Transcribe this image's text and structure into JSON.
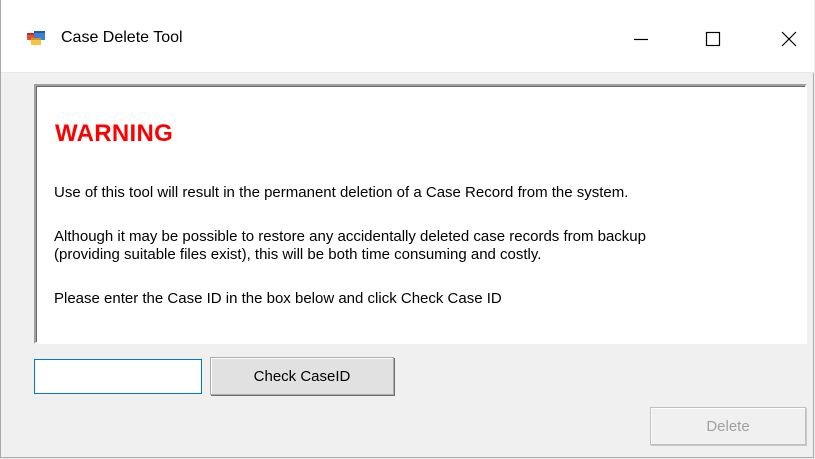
{
  "window": {
    "title": "Case Delete Tool",
    "icon": "form-app-icon",
    "controls": {
      "minimize_icon": "minimize-icon",
      "maximize_icon": "maximize-icon",
      "close_icon": "close-icon"
    }
  },
  "message": {
    "heading": "WARNING",
    "heading_color": "#ff0000",
    "paragraph1": "Use of this tool will result in the permanent deletion of a Case Record from the system.",
    "paragraph2_line1": "Although it may be possible to restore any accidentally deleted case records from backup",
    "paragraph2_line2": "(providing suitable files exist), this will be both time consuming and costly.",
    "paragraph3": "Please enter the Case ID in the box below and click Check Case ID"
  },
  "form": {
    "caseid_value": "",
    "check_button_label": "Check CaseID",
    "delete_button_label": "Delete",
    "delete_enabled": false
  }
}
